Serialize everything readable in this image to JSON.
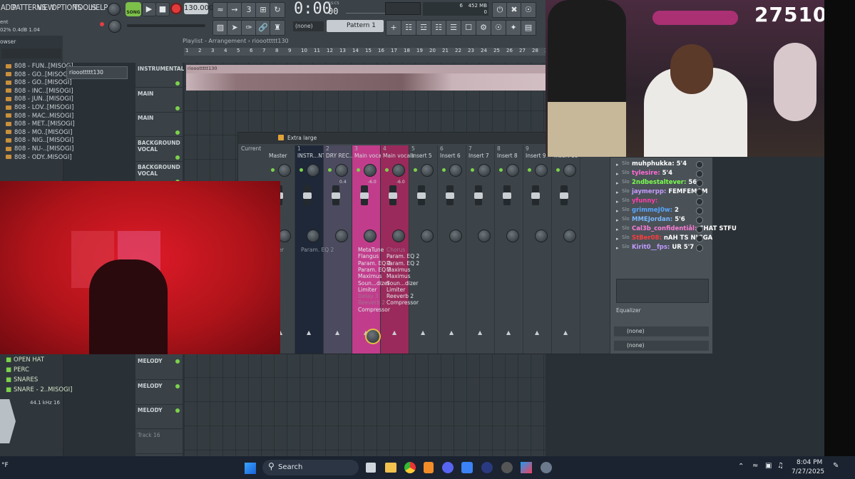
{
  "fl": {
    "menu": [
      "ADD",
      "PATTERNS",
      "VIEW",
      "OPTIONS",
      "TOOLS",
      "HELP"
    ],
    "song_label": "SONG",
    "bpm": "130.000",
    "time": "0:00",
    "time_sub": "00",
    "time_unit": "M:S:CS",
    "cpu": "6",
    "mem": "452 MB",
    "mem2": "0",
    "pattern": "Pattern 1",
    "none_label": "(none)",
    "hint_left": "ent",
    "hint_values": "02%  0.4dB  1.04",
    "browser_label": "owser",
    "playlist_path": "Playlist - Arrangement › riooottttt130",
    "pattern_selector": "riooottttt130",
    "clip_label": "riooottttt130",
    "timeline": [
      "1",
      "2",
      "3",
      "4",
      "5",
      "6",
      "7",
      "8",
      "9",
      "10",
      "11",
      "12",
      "13",
      "14",
      "15",
      "16",
      "17",
      "18",
      "19",
      "20",
      "21",
      "22",
      "23",
      "24",
      "25",
      "26",
      "27",
      "28",
      "29"
    ]
  },
  "browser_items": [
    "808 - FUN..[MISOG]",
    "808 - GO..[MISOGI]",
    "808 - GO..[MISOGI]",
    "808 - INC..[MISOGI]",
    "808 - JUN..[MISOGI]",
    "808 - LOV..[MISOGI]",
    "808 - MAC..MISOGI]",
    "808 - MET..[MISOGI]",
    "808 - MO..[MISOGI]",
    "808 - NIG..[MISOGI]",
    "808 - NU-..[MISOGI]",
    "808 - ODY..MISOGI]"
  ],
  "browser_lower": [
    "OPEN HAT",
    "PERC",
    "SNARES",
    "SNARE - 2..MISOGI]"
  ],
  "sample_info": "44.1 kHz 16",
  "tracks_top": [
    "INSTRUMENTAL",
    "MAIN",
    "MAIN",
    "BACKGROUND VOCAL",
    "BACKGROUND VOCAL"
  ],
  "tracks_bottom": [
    "MELODY",
    "MELODY",
    "MELODY",
    "Track 16"
  ],
  "mixer": {
    "size_label": "Extra large",
    "current_label": "Current",
    "strips": [
      {
        "num": "",
        "name": "Master"
      },
      {
        "num": "1",
        "name": "INSTR...NTAL"
      },
      {
        "num": "2",
        "name": "DRY REC..!"
      },
      {
        "num": "3",
        "name": "Main vocals"
      },
      {
        "num": "4",
        "name": "Main vocals"
      },
      {
        "num": "5",
        "name": "Insert 5"
      },
      {
        "num": "6",
        "name": "Insert 6"
      },
      {
        "num": "7",
        "name": "Insert 7"
      },
      {
        "num": "8",
        "name": "Insert 8"
      },
      {
        "num": "9",
        "name": "Insert 9"
      },
      {
        "num": "",
        "name": "Insert 10"
      }
    ],
    "db_values": [
      "0.4",
      "-6.0",
      "-6.0"
    ],
    "order_label": "order",
    "order_label2": "er",
    "insert1_fx": "Param. EQ 2",
    "insert3_fx": [
      "MetaTune",
      "Flangus",
      "Param. EQ 2",
      "Param. EQ 2",
      "Maximus",
      "Soun...dizer",
      "Limiter",
      "Delay 3",
      "Reeverb 2",
      "Compressor"
    ],
    "insert4_fx": [
      "Chorus",
      "Param. EQ 2",
      "Param. EQ 2",
      "Maximus",
      "Maximus",
      "Soun...dizer",
      "Limiter",
      "Reeverb 2",
      "Compressor"
    ],
    "equalizer_label": "Equalizer",
    "none_a": "(none)",
    "none_b": "(none)",
    "slot_label": "Slo"
  },
  "chat": [
    {
      "user": "muhphukka:",
      "msg": "5'4",
      "color": "#ffffff"
    },
    {
      "user": "tylesire:",
      "msg": "5'4",
      "color": "#ff6ad5"
    },
    {
      "user": "2ndbestaltever:",
      "msg": "56",
      "color": "#7cff4d"
    },
    {
      "user": "jaymerpp:",
      "msg": "FEMFEMAM",
      "color": "#c79bff"
    },
    {
      "user": "yfunny:",
      "msg": "",
      "color": "#ff3da8"
    },
    {
      "user": "grimmeJ0w:",
      "msg": "2",
      "color": "#58a6ff"
    },
    {
      "user": "MMEJordan:",
      "msg": "5'6",
      "color": "#7ab8ff"
    },
    {
      "user": "Cal3b_confidentiål:",
      "msg": "CHAT STFU",
      "color": "#ff7bd8"
    },
    {
      "user": "StBer08:",
      "msg": "nAH TS NIGGA",
      "color": "#ff3b3b"
    },
    {
      "user": "Kirit0__fps:",
      "msg": "UR 5'7",
      "color": "#c19bff"
    }
  ],
  "stream": {
    "counter": "27510"
  },
  "taskbar": {
    "search": "Search",
    "time": "8:04 PM",
    "date": "7/27/2025",
    "weather": "°F"
  },
  "colors": {
    "accent_green": "#7cd24a",
    "insert3": "#c13d8c",
    "insert4": "#9a2a5b",
    "cam_red": "#b0141a"
  }
}
